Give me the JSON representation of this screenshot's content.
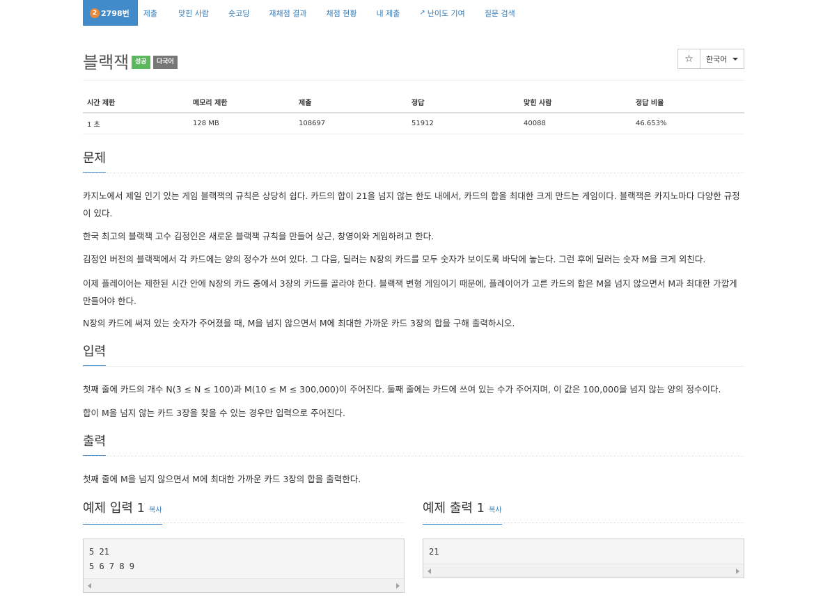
{
  "nav": {
    "problem_number": "2798번",
    "problem_badge": "2",
    "items": [
      "제출",
      "맞힌 사람",
      "숏코딩",
      "재채점 결과",
      "채점 현황",
      "내 제출",
      "난이도 기여",
      "질문 검색"
    ]
  },
  "title": "블랙잭",
  "labels": {
    "success": "성공",
    "multilang": "다국어"
  },
  "toolbar": {
    "star": "☆",
    "language": "한국어"
  },
  "info_table": {
    "headers": [
      "시간 제한",
      "메모리 제한",
      "제출",
      "정답",
      "맞힌 사람",
      "정답 비율"
    ],
    "values": [
      "1 초",
      "128 MB",
      "108697",
      "51912",
      "40088",
      "46.653%"
    ]
  },
  "sections": {
    "problem": {
      "heading": "문제",
      "paragraphs": [
        "카지노에서 제일 인기 있는 게임 블랙잭의 규칙은 상당히 쉽다. 카드의 합이 21을 넘지 않는 한도 내에서, 카드의 합을 최대한 크게 만드는 게임이다. 블랙잭은 카지노마다 다양한 규정이 있다.",
        "한국 최고의 블랙잭 고수 김정인은 새로운 블랙잭 규칙을 만들어 상근, 창영이와 게임하려고 한다.",
        "김정인 버전의 블랙잭에서 각 카드에는 양의 정수가 쓰여 있다. 그 다음, 딜러는 N장의 카드를 모두 숫자가 보이도록 바닥에 놓는다. 그런 후에 딜러는 숫자 M을 크게 외친다.",
        "이제 플레이어는 제한된 시간 안에 N장의 카드 중에서 3장의 카드를 골라야 한다. 블랙잭 변형 게임이기 때문에, 플레이어가 고른 카드의 합은 M을 넘지 않으면서 M과 최대한 가깝게 만들어야 한다.",
        "N장의 카드에 써져 있는 숫자가 주어졌을 때, M을 넘지 않으면서 M에 최대한 가까운 카드 3장의 합을 구해 출력하시오."
      ]
    },
    "input": {
      "heading": "입력",
      "paragraphs": [
        "첫째 줄에 카드의 개수 N(3 ≤ N ≤ 100)과 M(10 ≤ M ≤ 300,000)이 주어진다. 둘째 줄에는 카드에 쓰여 있는 수가 주어지며, 이 값은 100,000을 넘지 않는 양의 정수이다.",
        "합이 M을 넘지 않는 카드 3장을 찾을 수 있는 경우만 입력으로 주어진다."
      ]
    },
    "output": {
      "heading": "출력",
      "paragraphs": [
        "첫째 줄에 M을 넘지 않으면서 M에 최대한 가까운 카드 3장의 합을 출력한다."
      ]
    }
  },
  "samples": {
    "input": {
      "heading": "예제 입력 1",
      "copy": "복사",
      "code": "5 21\n5 6 7 8 9"
    },
    "output": {
      "heading": "예제 출력 1",
      "copy": "복사",
      "code": "21"
    }
  }
}
